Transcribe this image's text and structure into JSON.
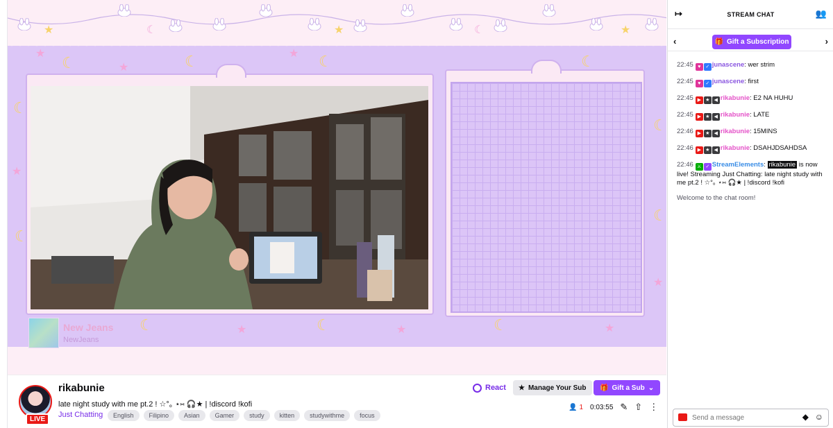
{
  "stream": {
    "now_playing": {
      "song": "New Jeans",
      "artist": "NewJeans"
    }
  },
  "channel": {
    "name": "rikabunie",
    "live_label": "LIVE",
    "title": "late night study with me pt.2 ! ☆°｡ ⋆⑅ 🎧★ | !discord !kofi",
    "category": "Just Chatting",
    "tags": [
      "English",
      "Filipino",
      "Asian",
      "Gamer",
      "study",
      "kitten",
      "studywithme",
      "focus"
    ]
  },
  "actions": {
    "react": "React",
    "manage_sub": "Manage Your Sub",
    "gift_sub": "Gift a Sub",
    "viewers": "1",
    "uptime": "0:03:55"
  },
  "chat": {
    "title": "STREAM CHAT",
    "gift_subscription": "Gift a Subscription",
    "messages": [
      {
        "time": "22:45",
        "user": "junascene",
        "text": ": wer strim"
      },
      {
        "time": "22:45",
        "user": "junascene",
        "text": ": first"
      },
      {
        "time": "22:45",
        "user": "rikabunie",
        "text": ": E2 NA HUHU"
      },
      {
        "time": "22:45",
        "user": "rikabunie",
        "text": ": LATE"
      },
      {
        "time": "22:46",
        "user": "rikabunie",
        "text": ": 15MINS"
      },
      {
        "time": "22:46",
        "user": "rikabunie",
        "text": ": DSAHJDSAHDSA"
      },
      {
        "time": "22:46",
        "user": "StreamElements",
        "mention": "rikabunie",
        "text": " is now live! Streaming Just Chatting: late night study with me pt.2 ! ☆°｡ ⋆⑅ 🎧★ | !discord !kofi"
      }
    ],
    "welcome": "Welcome to the chat room!",
    "input_placeholder": "Send a message"
  },
  "colors": {
    "accent": "#9147ff",
    "live": "#e91916",
    "stream_bg": "#dcc6f7",
    "band": "#fdeef6"
  }
}
